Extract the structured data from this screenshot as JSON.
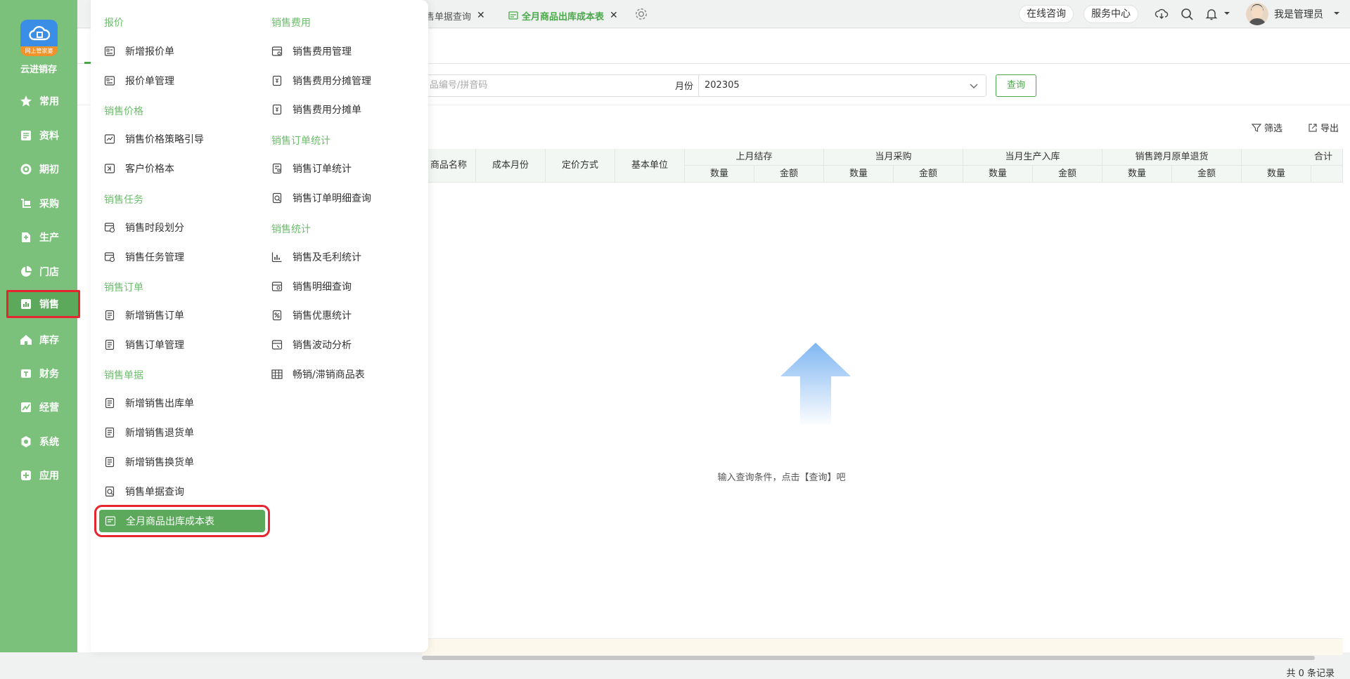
{
  "app": {
    "name": "云进销存",
    "logo_badge": "网上管家婆"
  },
  "sidebar": {
    "items": [
      {
        "label": "常用",
        "icon": "star-icon"
      },
      {
        "label": "资料",
        "icon": "document-icon"
      },
      {
        "label": "期初",
        "icon": "target-icon"
      },
      {
        "label": "采购",
        "icon": "cart-icon"
      },
      {
        "label": "生产",
        "icon": "factory-icon"
      },
      {
        "label": "门店",
        "icon": "pie-icon"
      },
      {
        "label": "销售",
        "icon": "bar-chart-icon",
        "active": true
      },
      {
        "label": "库存",
        "icon": "house-icon"
      },
      {
        "label": "财务",
        "icon": "finance-icon"
      },
      {
        "label": "经营",
        "icon": "trend-icon"
      },
      {
        "label": "系统",
        "icon": "gear-icon"
      },
      {
        "label": "应用",
        "icon": "plus-square-icon"
      }
    ]
  },
  "topbar": {
    "tabs": [
      {
        "label": "售单据查询",
        "closable": true
      },
      {
        "label": "全月商品出库成本表",
        "closable": true,
        "active": true
      }
    ],
    "online_consult": "在线咨询",
    "service_center": "服务中心",
    "user_name": "我是管理员"
  },
  "menu": {
    "col1": [
      {
        "category": "报价",
        "items": [
          "新增报价单",
          "报价单管理"
        ]
      },
      {
        "category": "销售价格",
        "items": [
          "销售价格策略引导",
          "客户价格本"
        ]
      },
      {
        "category": "销售任务",
        "items": [
          "销售时段划分",
          "销售任务管理"
        ]
      },
      {
        "category": "销售订单",
        "items": [
          "新增销售订单",
          "销售订单管理"
        ]
      },
      {
        "category": "销售单据",
        "items": [
          "新增销售出库单",
          "新增销售退货单",
          "新增销售换货单",
          "销售单据查询",
          "全月商品出库成本表"
        ]
      }
    ],
    "col2": [
      {
        "category": "销售费用",
        "items": [
          "销售费用管理",
          "销售费用分摊管理",
          "销售费用分摊单"
        ]
      },
      {
        "category": "销售订单统计",
        "items": [
          "销售订单统计",
          "销售订单明细查询"
        ]
      },
      {
        "category": "销售统计",
        "items": [
          "销售及毛利统计",
          "销售明细查询",
          "销售优惠统计",
          "销售波动分析",
          "畅销/滞销商品表"
        ]
      }
    ]
  },
  "filters": {
    "search_placeholder": "品编号/拼音码",
    "month_label": "月份",
    "month_value": "202305",
    "query_button": "查询"
  },
  "toolbar": {
    "filter_label": "筛选",
    "export_label": "导出"
  },
  "table": {
    "single_headers": [
      "商品名称",
      "成本月份",
      "定价方式",
      "基本单位"
    ],
    "group_headers": [
      "上月结存",
      "当月采购",
      "当月生产入库",
      "销售跨月原单退货",
      "合计"
    ],
    "sub_headers": [
      "数量",
      "金额",
      "数量",
      "金额",
      "数量",
      "金额",
      "数量",
      "金额",
      "数量"
    ]
  },
  "empty_hint": "输入查询条件，点击【查询】吧",
  "record_count": "共 0 条记录",
  "colors": {
    "sidebar_bg": "#7bc17b",
    "accent": "#4aa84a",
    "menu_category": "#6cbd6c",
    "highlight_border": "#e5262e"
  }
}
